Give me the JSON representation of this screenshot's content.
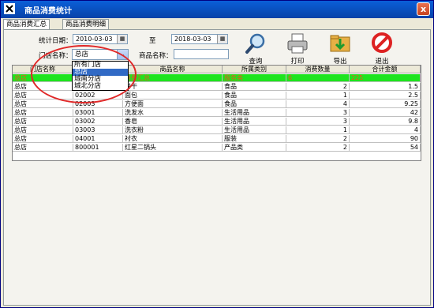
{
  "window": {
    "title": "商品消费统计",
    "close_label": "x"
  },
  "tabs": [
    {
      "label": "商品消费汇总"
    },
    {
      "label": "商品消费明细"
    }
  ],
  "filters": {
    "date_label": "统计日期：",
    "date_from": "2010-03-03",
    "to_label": "至",
    "date_to": "2018-03-03",
    "store_label": "门店名称：",
    "store_value": "总店",
    "product_label": "商品名称：",
    "product_value": ""
  },
  "store_options": [
    "所有门店",
    "总店",
    "城南分店",
    "城北分店"
  ],
  "toolbar": {
    "query": "查询",
    "print": "打印",
    "export": "导出",
    "exit": "退出"
  },
  "table": {
    "columns": [
      "门店名称",
      "",
      "商品名称",
      "所属类别",
      "消费数量",
      "合计金额"
    ],
    "summary": {
      "store": "总店",
      "product": "消费汇总",
      "category": "服务类",
      "qty": "6",
      "amount": "225"
    },
    "rows": [
      {
        "store": "总店",
        "code": "02001",
        "name": "饼干",
        "category": "食品",
        "qty": "2",
        "amount": "1.5"
      },
      {
        "store": "总店",
        "code": "02002",
        "name": "面包",
        "category": "食品",
        "qty": "1",
        "amount": "2.5"
      },
      {
        "store": "总店",
        "code": "02003",
        "name": "方便面",
        "category": "食品",
        "qty": "4",
        "amount": "9.25"
      },
      {
        "store": "总店",
        "code": "03001",
        "name": "洗发水",
        "category": "生活用品",
        "qty": "3",
        "amount": "42"
      },
      {
        "store": "总店",
        "code": "03002",
        "name": "香皂",
        "category": "生活用品",
        "qty": "3",
        "amount": "9.8"
      },
      {
        "store": "总店",
        "code": "03003",
        "name": "洗衣粉",
        "category": "生活用品",
        "qty": "1",
        "amount": "4"
      },
      {
        "store": "总店",
        "code": "04001",
        "name": "衬衣",
        "category": "服装",
        "qty": "2",
        "amount": "90"
      },
      {
        "store": "总店",
        "code": "800001",
        "name": "红星二锅头",
        "category": "产品类",
        "qty": "2",
        "amount": "54"
      }
    ]
  }
}
